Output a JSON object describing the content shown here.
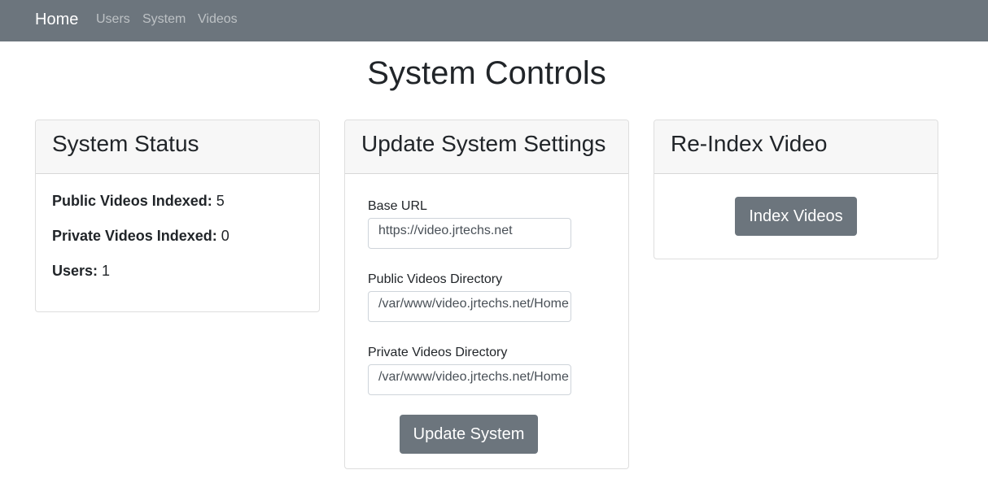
{
  "navbar": {
    "brand": "Home",
    "links": [
      "Users",
      "System",
      "Videos"
    ]
  },
  "page": {
    "title": "System Controls"
  },
  "status_card": {
    "title": "System Status",
    "public_label": "Public Videos Indexed:",
    "public_value": "5",
    "private_label": "Private Videos Indexed:",
    "private_value": "0",
    "users_label": "Users:",
    "users_value": "1"
  },
  "settings_card": {
    "title": "Update System Settings",
    "base_url_label": "Base URL",
    "base_url_value": "https://video.jrtechs.net",
    "public_dir_label": "Public Videos Directory",
    "public_dir_value": "/var/www/video.jrtechs.net/Home",
    "private_dir_label": "Private Videos Directory",
    "private_dir_value": "/var/www/video.jrtechs.net/Home",
    "submit_label": "Update System"
  },
  "reindex_card": {
    "title": "Re-Index Video",
    "button_label": "Index Videos"
  },
  "colors": {
    "navbar": "#6c757d",
    "button": "#6c757d",
    "card_header": "#f7f7f7"
  }
}
